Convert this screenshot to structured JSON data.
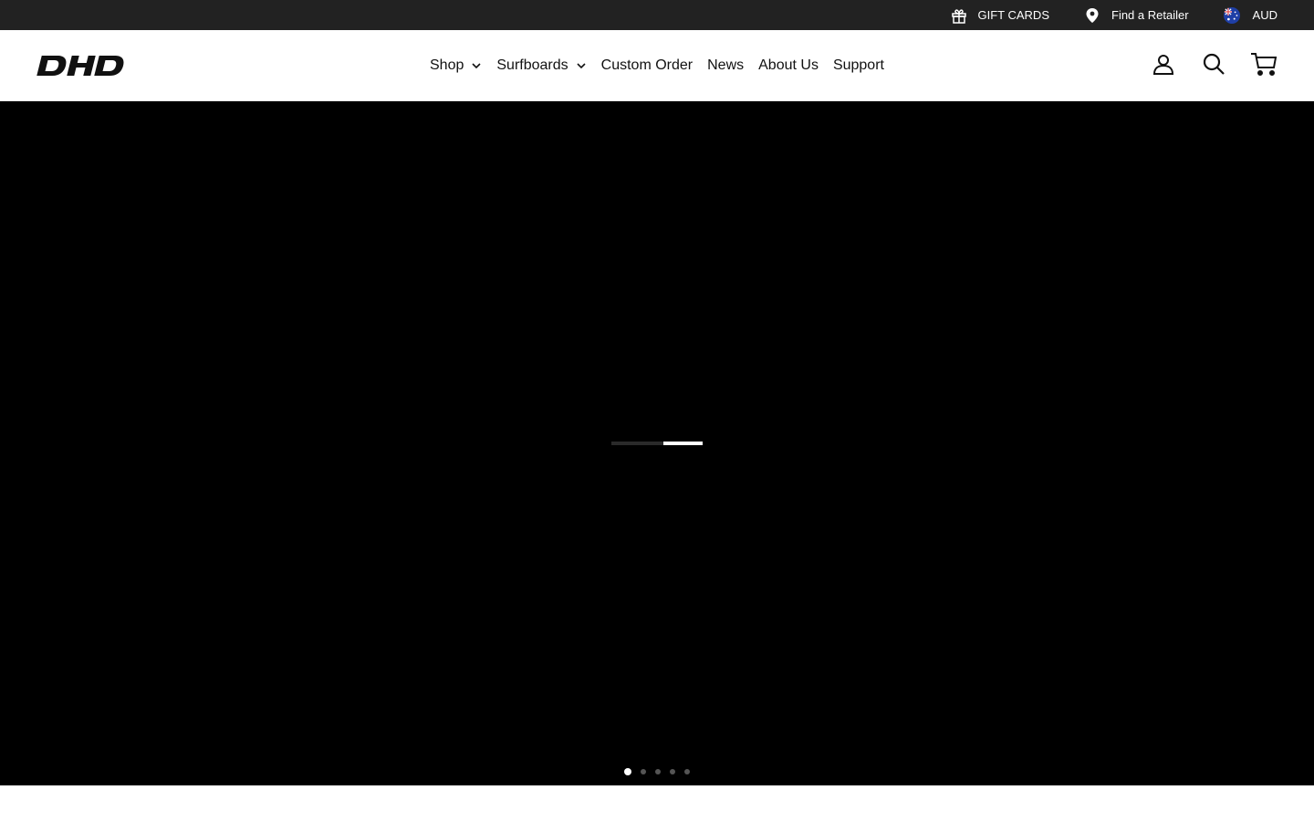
{
  "utility_bar": {
    "background": "#222222",
    "links": [
      {
        "label": "GIFT CARDS",
        "icon": "gift-icon"
      },
      {
        "label": "Find a Retailer",
        "icon": "map-pin-icon"
      },
      {
        "label": "AUD",
        "icon": "australia-flag-icon"
      }
    ]
  },
  "header": {
    "logo_text": "DHD",
    "nav": [
      {
        "label": "Shop",
        "has_dropdown": true
      },
      {
        "label": "Surfboards",
        "has_dropdown": true
      },
      {
        "label": "Custom Order",
        "has_dropdown": false
      },
      {
        "label": "News",
        "has_dropdown": false
      },
      {
        "label": "About Us",
        "has_dropdown": false
      },
      {
        "label": "Support",
        "has_dropdown": false
      }
    ],
    "icons": [
      "account-icon",
      "search-icon",
      "cart-icon"
    ]
  },
  "hero": {
    "background": "#000000",
    "loader_progress": 0.43,
    "slides_total": 5,
    "active_slide": 1
  }
}
